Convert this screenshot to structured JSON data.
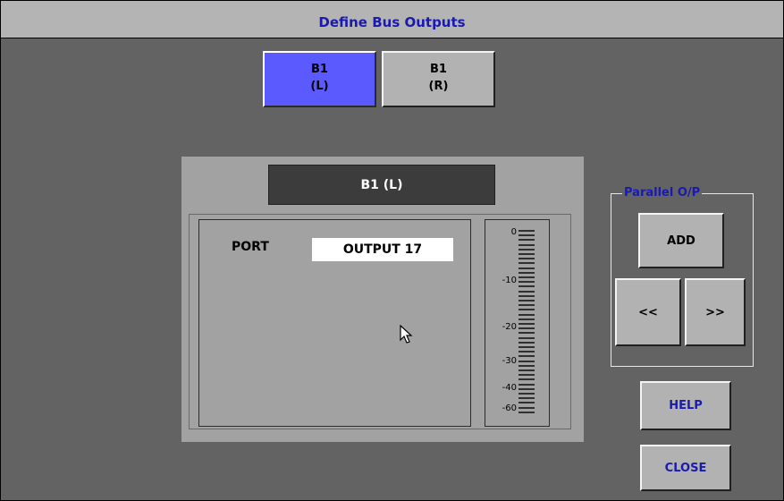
{
  "window": {
    "title": "Define Bus Outputs"
  },
  "bus_selector": [
    {
      "line1": "B1",
      "line2": "(L)",
      "selected": true
    },
    {
      "line1": "B1",
      "line2": "(R)",
      "selected": false
    }
  ],
  "panel": {
    "title": "B1 (L)",
    "port_label": "PORT",
    "port_value": "OUTPUT 17"
  },
  "meter": {
    "ticks": [
      "0",
      "-10",
      "-20",
      "-30",
      "-40",
      "-60"
    ],
    "segments": 40
  },
  "parallel": {
    "label": "Parallel O/P",
    "add_label": "ADD",
    "prev_label": "<<",
    "next_label": ">>"
  },
  "help_label": "HELP",
  "close_label": "CLOSE",
  "colors": {
    "selected_bus": "#5a5aff",
    "title_text": "#1a1ab0",
    "background": "#636363",
    "panel": "#a2a2a2"
  }
}
